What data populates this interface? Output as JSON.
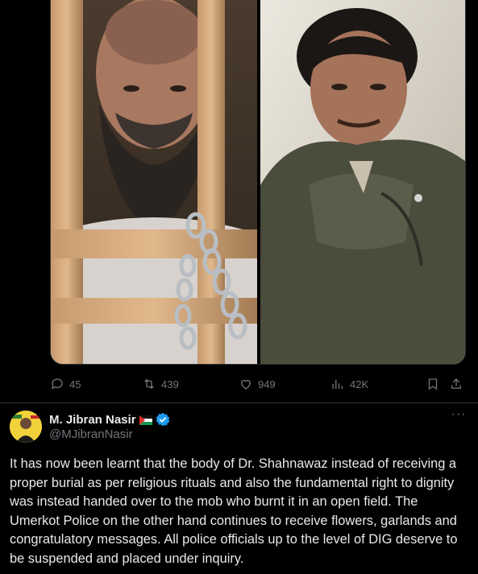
{
  "media": {
    "photos": [
      {
        "name": "photo-left"
      },
      {
        "name": "photo-right"
      }
    ]
  },
  "actions": {
    "replies": "45",
    "reposts": "439",
    "likes": "949",
    "views": "42K"
  },
  "icons": {
    "reply": "reply-icon",
    "repost": "repost-icon",
    "like": "heart-icon",
    "views": "views-chart-icon",
    "bookmark": "bookmark-icon",
    "share": "share-icon",
    "more": "more-icon",
    "verified": "verified-badge-icon",
    "flag": "palestine-flag-icon"
  },
  "colors": {
    "background": "#000000",
    "text": "#e7e9ea",
    "muted": "#71767b",
    "verified": "#1d9bf0",
    "divider": "#2f3336"
  },
  "reply_tweet": {
    "author_name": "M. Jibran Nasir",
    "handle": "@MJibranNasir",
    "more_label": "···",
    "text": "It has now been learnt that the body of Dr. Shahnawaz instead of receiving a proper burial as per religious rituals and also the fundamental right to dignity was instead handed over to the mob who burnt it in an open field. The Umerkot Police on the other hand continues to receive flowers, garlands and congratulatory messages. All police officials up to the level of DIG deserve to be suspended and placed under inquiry."
  }
}
